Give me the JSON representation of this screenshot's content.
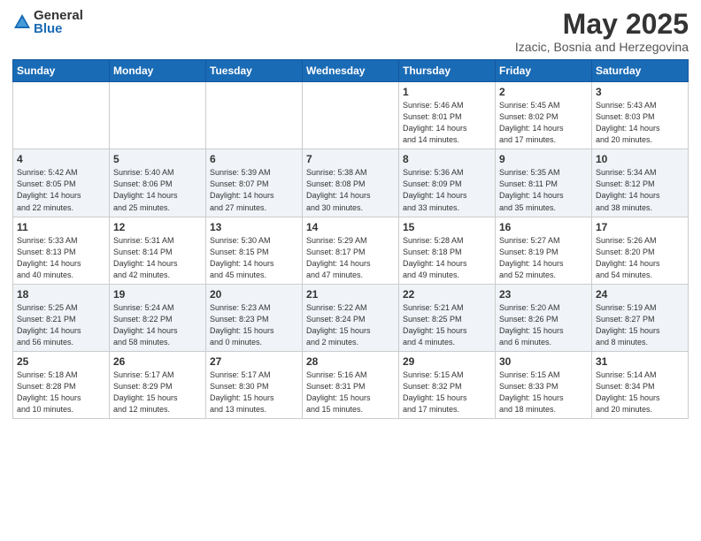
{
  "header": {
    "logo_general": "General",
    "logo_blue": "Blue",
    "month_title": "May 2025",
    "location": "Izacic, Bosnia and Herzegovina"
  },
  "days_of_week": [
    "Sunday",
    "Monday",
    "Tuesday",
    "Wednesday",
    "Thursday",
    "Friday",
    "Saturday"
  ],
  "weeks": [
    [
      {
        "day": "",
        "detail": ""
      },
      {
        "day": "",
        "detail": ""
      },
      {
        "day": "",
        "detail": ""
      },
      {
        "day": "",
        "detail": ""
      },
      {
        "day": "1",
        "detail": "Sunrise: 5:46 AM\nSunset: 8:01 PM\nDaylight: 14 hours\nand 14 minutes."
      },
      {
        "day": "2",
        "detail": "Sunrise: 5:45 AM\nSunset: 8:02 PM\nDaylight: 14 hours\nand 17 minutes."
      },
      {
        "day": "3",
        "detail": "Sunrise: 5:43 AM\nSunset: 8:03 PM\nDaylight: 14 hours\nand 20 minutes."
      }
    ],
    [
      {
        "day": "4",
        "detail": "Sunrise: 5:42 AM\nSunset: 8:05 PM\nDaylight: 14 hours\nand 22 minutes."
      },
      {
        "day": "5",
        "detail": "Sunrise: 5:40 AM\nSunset: 8:06 PM\nDaylight: 14 hours\nand 25 minutes."
      },
      {
        "day": "6",
        "detail": "Sunrise: 5:39 AM\nSunset: 8:07 PM\nDaylight: 14 hours\nand 27 minutes."
      },
      {
        "day": "7",
        "detail": "Sunrise: 5:38 AM\nSunset: 8:08 PM\nDaylight: 14 hours\nand 30 minutes."
      },
      {
        "day": "8",
        "detail": "Sunrise: 5:36 AM\nSunset: 8:09 PM\nDaylight: 14 hours\nand 33 minutes."
      },
      {
        "day": "9",
        "detail": "Sunrise: 5:35 AM\nSunset: 8:11 PM\nDaylight: 14 hours\nand 35 minutes."
      },
      {
        "day": "10",
        "detail": "Sunrise: 5:34 AM\nSunset: 8:12 PM\nDaylight: 14 hours\nand 38 minutes."
      }
    ],
    [
      {
        "day": "11",
        "detail": "Sunrise: 5:33 AM\nSunset: 8:13 PM\nDaylight: 14 hours\nand 40 minutes."
      },
      {
        "day": "12",
        "detail": "Sunrise: 5:31 AM\nSunset: 8:14 PM\nDaylight: 14 hours\nand 42 minutes."
      },
      {
        "day": "13",
        "detail": "Sunrise: 5:30 AM\nSunset: 8:15 PM\nDaylight: 14 hours\nand 45 minutes."
      },
      {
        "day": "14",
        "detail": "Sunrise: 5:29 AM\nSunset: 8:17 PM\nDaylight: 14 hours\nand 47 minutes."
      },
      {
        "day": "15",
        "detail": "Sunrise: 5:28 AM\nSunset: 8:18 PM\nDaylight: 14 hours\nand 49 minutes."
      },
      {
        "day": "16",
        "detail": "Sunrise: 5:27 AM\nSunset: 8:19 PM\nDaylight: 14 hours\nand 52 minutes."
      },
      {
        "day": "17",
        "detail": "Sunrise: 5:26 AM\nSunset: 8:20 PM\nDaylight: 14 hours\nand 54 minutes."
      }
    ],
    [
      {
        "day": "18",
        "detail": "Sunrise: 5:25 AM\nSunset: 8:21 PM\nDaylight: 14 hours\nand 56 minutes."
      },
      {
        "day": "19",
        "detail": "Sunrise: 5:24 AM\nSunset: 8:22 PM\nDaylight: 14 hours\nand 58 minutes."
      },
      {
        "day": "20",
        "detail": "Sunrise: 5:23 AM\nSunset: 8:23 PM\nDaylight: 15 hours\nand 0 minutes."
      },
      {
        "day": "21",
        "detail": "Sunrise: 5:22 AM\nSunset: 8:24 PM\nDaylight: 15 hours\nand 2 minutes."
      },
      {
        "day": "22",
        "detail": "Sunrise: 5:21 AM\nSunset: 8:25 PM\nDaylight: 15 hours\nand 4 minutes."
      },
      {
        "day": "23",
        "detail": "Sunrise: 5:20 AM\nSunset: 8:26 PM\nDaylight: 15 hours\nand 6 minutes."
      },
      {
        "day": "24",
        "detail": "Sunrise: 5:19 AM\nSunset: 8:27 PM\nDaylight: 15 hours\nand 8 minutes."
      }
    ],
    [
      {
        "day": "25",
        "detail": "Sunrise: 5:18 AM\nSunset: 8:28 PM\nDaylight: 15 hours\nand 10 minutes."
      },
      {
        "day": "26",
        "detail": "Sunrise: 5:17 AM\nSunset: 8:29 PM\nDaylight: 15 hours\nand 12 minutes."
      },
      {
        "day": "27",
        "detail": "Sunrise: 5:17 AM\nSunset: 8:30 PM\nDaylight: 15 hours\nand 13 minutes."
      },
      {
        "day": "28",
        "detail": "Sunrise: 5:16 AM\nSunset: 8:31 PM\nDaylight: 15 hours\nand 15 minutes."
      },
      {
        "day": "29",
        "detail": "Sunrise: 5:15 AM\nSunset: 8:32 PM\nDaylight: 15 hours\nand 17 minutes."
      },
      {
        "day": "30",
        "detail": "Sunrise: 5:15 AM\nSunset: 8:33 PM\nDaylight: 15 hours\nand 18 minutes."
      },
      {
        "day": "31",
        "detail": "Sunrise: 5:14 AM\nSunset: 8:34 PM\nDaylight: 15 hours\nand 20 minutes."
      }
    ]
  ]
}
